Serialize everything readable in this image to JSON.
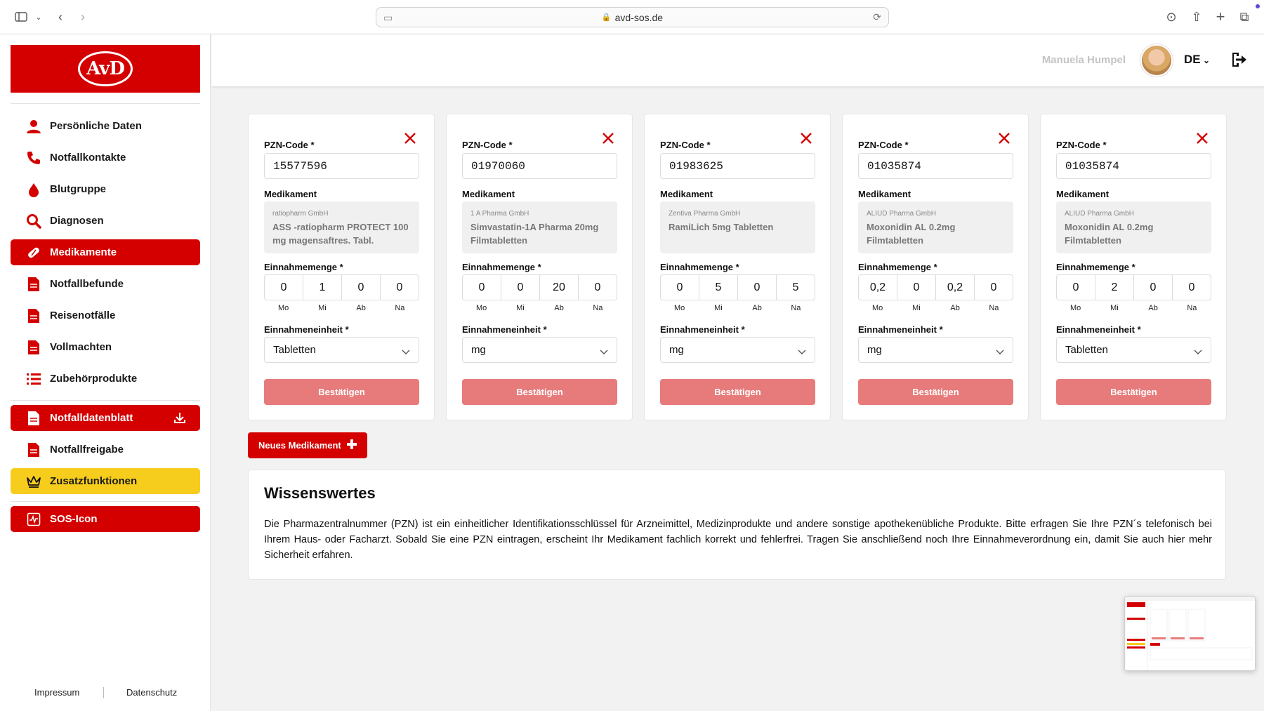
{
  "browser": {
    "url": "avd-sos.de"
  },
  "sidebar": {
    "logo_text": "AvD",
    "items": [
      {
        "label": "Persönliche Daten",
        "icon": "person-icon"
      },
      {
        "label": "Notfallkontakte",
        "icon": "phone-icon"
      },
      {
        "label": "Blutgruppe",
        "icon": "blood-drop-icon"
      },
      {
        "label": "Diagnosen",
        "icon": "search-icon"
      },
      {
        "label": "Medikamente",
        "icon": "pill-icon"
      },
      {
        "label": "Notfallbefunde",
        "icon": "document-icon"
      },
      {
        "label": "Reisenotfälle",
        "icon": "document-icon"
      },
      {
        "label": "Vollmachten",
        "icon": "document-icon"
      },
      {
        "label": "Zubehörprodukte",
        "icon": "list-icon"
      }
    ],
    "secondary": [
      {
        "label": "Notfalldatenblatt",
        "icon": "document-icon"
      },
      {
        "label": "Notfallfreigabe",
        "icon": "document-icon"
      },
      {
        "label": "Zusatzfunktionen",
        "icon": "crown-icon"
      },
      {
        "label": "SOS-Icon",
        "icon": "sos-icon"
      }
    ],
    "footer": {
      "impressum": "Impressum",
      "datenschutz": "Datenschutz"
    },
    "colors": {
      "brand_red": "#d40000",
      "premium_yellow": "#f7cd1d"
    }
  },
  "header": {
    "user_name": "Manuela Humpel",
    "language": "DE"
  },
  "labels": {
    "pzn": "PZN-Code *",
    "medikament": "Medikament",
    "einnahmemenge": "Einnahmemenge *",
    "einnahmeeinheit": "Einnahmeneinheit *",
    "confirm": "Bestätigen",
    "days": [
      "Mo",
      "Mi",
      "Ab",
      "Na"
    ]
  },
  "medications": [
    {
      "pzn": "15577596",
      "manufacturer": "ratiopharm GmbH",
      "name": "ASS -ratiopharm PROTECT 100 mg magensaftres. Tabl.",
      "amounts": [
        "0",
        "1",
        "0",
        "0"
      ],
      "unit": "Tabletten"
    },
    {
      "pzn": "01970060",
      "manufacturer": "1 A Pharma GmbH",
      "name": "Simvastatin-1A Pharma 20mg Filmtabletten",
      "amounts": [
        "0",
        "0",
        "20",
        "0"
      ],
      "unit": "mg"
    },
    {
      "pzn": "01983625",
      "manufacturer": "Zentiva Pharma GmbH",
      "name": "RamiLich 5mg Tabletten",
      "amounts": [
        "0",
        "5",
        "0",
        "5"
      ],
      "unit": "mg"
    },
    {
      "pzn": "01035874",
      "manufacturer": "ALIUD Pharma GmbH",
      "name": "Moxonidin AL 0.2mg Filmtabletten",
      "amounts": [
        "0,2",
        "0",
        "0,2",
        "0"
      ],
      "unit": "mg"
    },
    {
      "pzn": "01035874",
      "manufacturer": "ALIUD Pharma GmbH",
      "name": "Moxonidin AL 0.2mg Filmtabletten",
      "amounts": [
        "0",
        "2",
        "0",
        "0"
      ],
      "unit": "Tabletten"
    }
  ],
  "new_button": "Neues Medikament",
  "info": {
    "title": "Wissenswertes",
    "text": "Die Pharmazentralnummer (PZN) ist ein einheitlicher Identifikationsschlüssel für Arzneimittel, Medizinprodukte und andere sonstige apothekenübliche Produkte. Bitte erfragen Sie Ihre PZN´s telefonisch bei Ihrem Haus- oder Facharzt. Sobald Sie eine PZN eintragen, erscheint Ihr Medikament fachlich korrekt und fehlerfrei. Tragen Sie anschließend noch Ihre Einnahmeverordnung ein, damit Sie auch hier mehr Sicherheit erfahren."
  }
}
